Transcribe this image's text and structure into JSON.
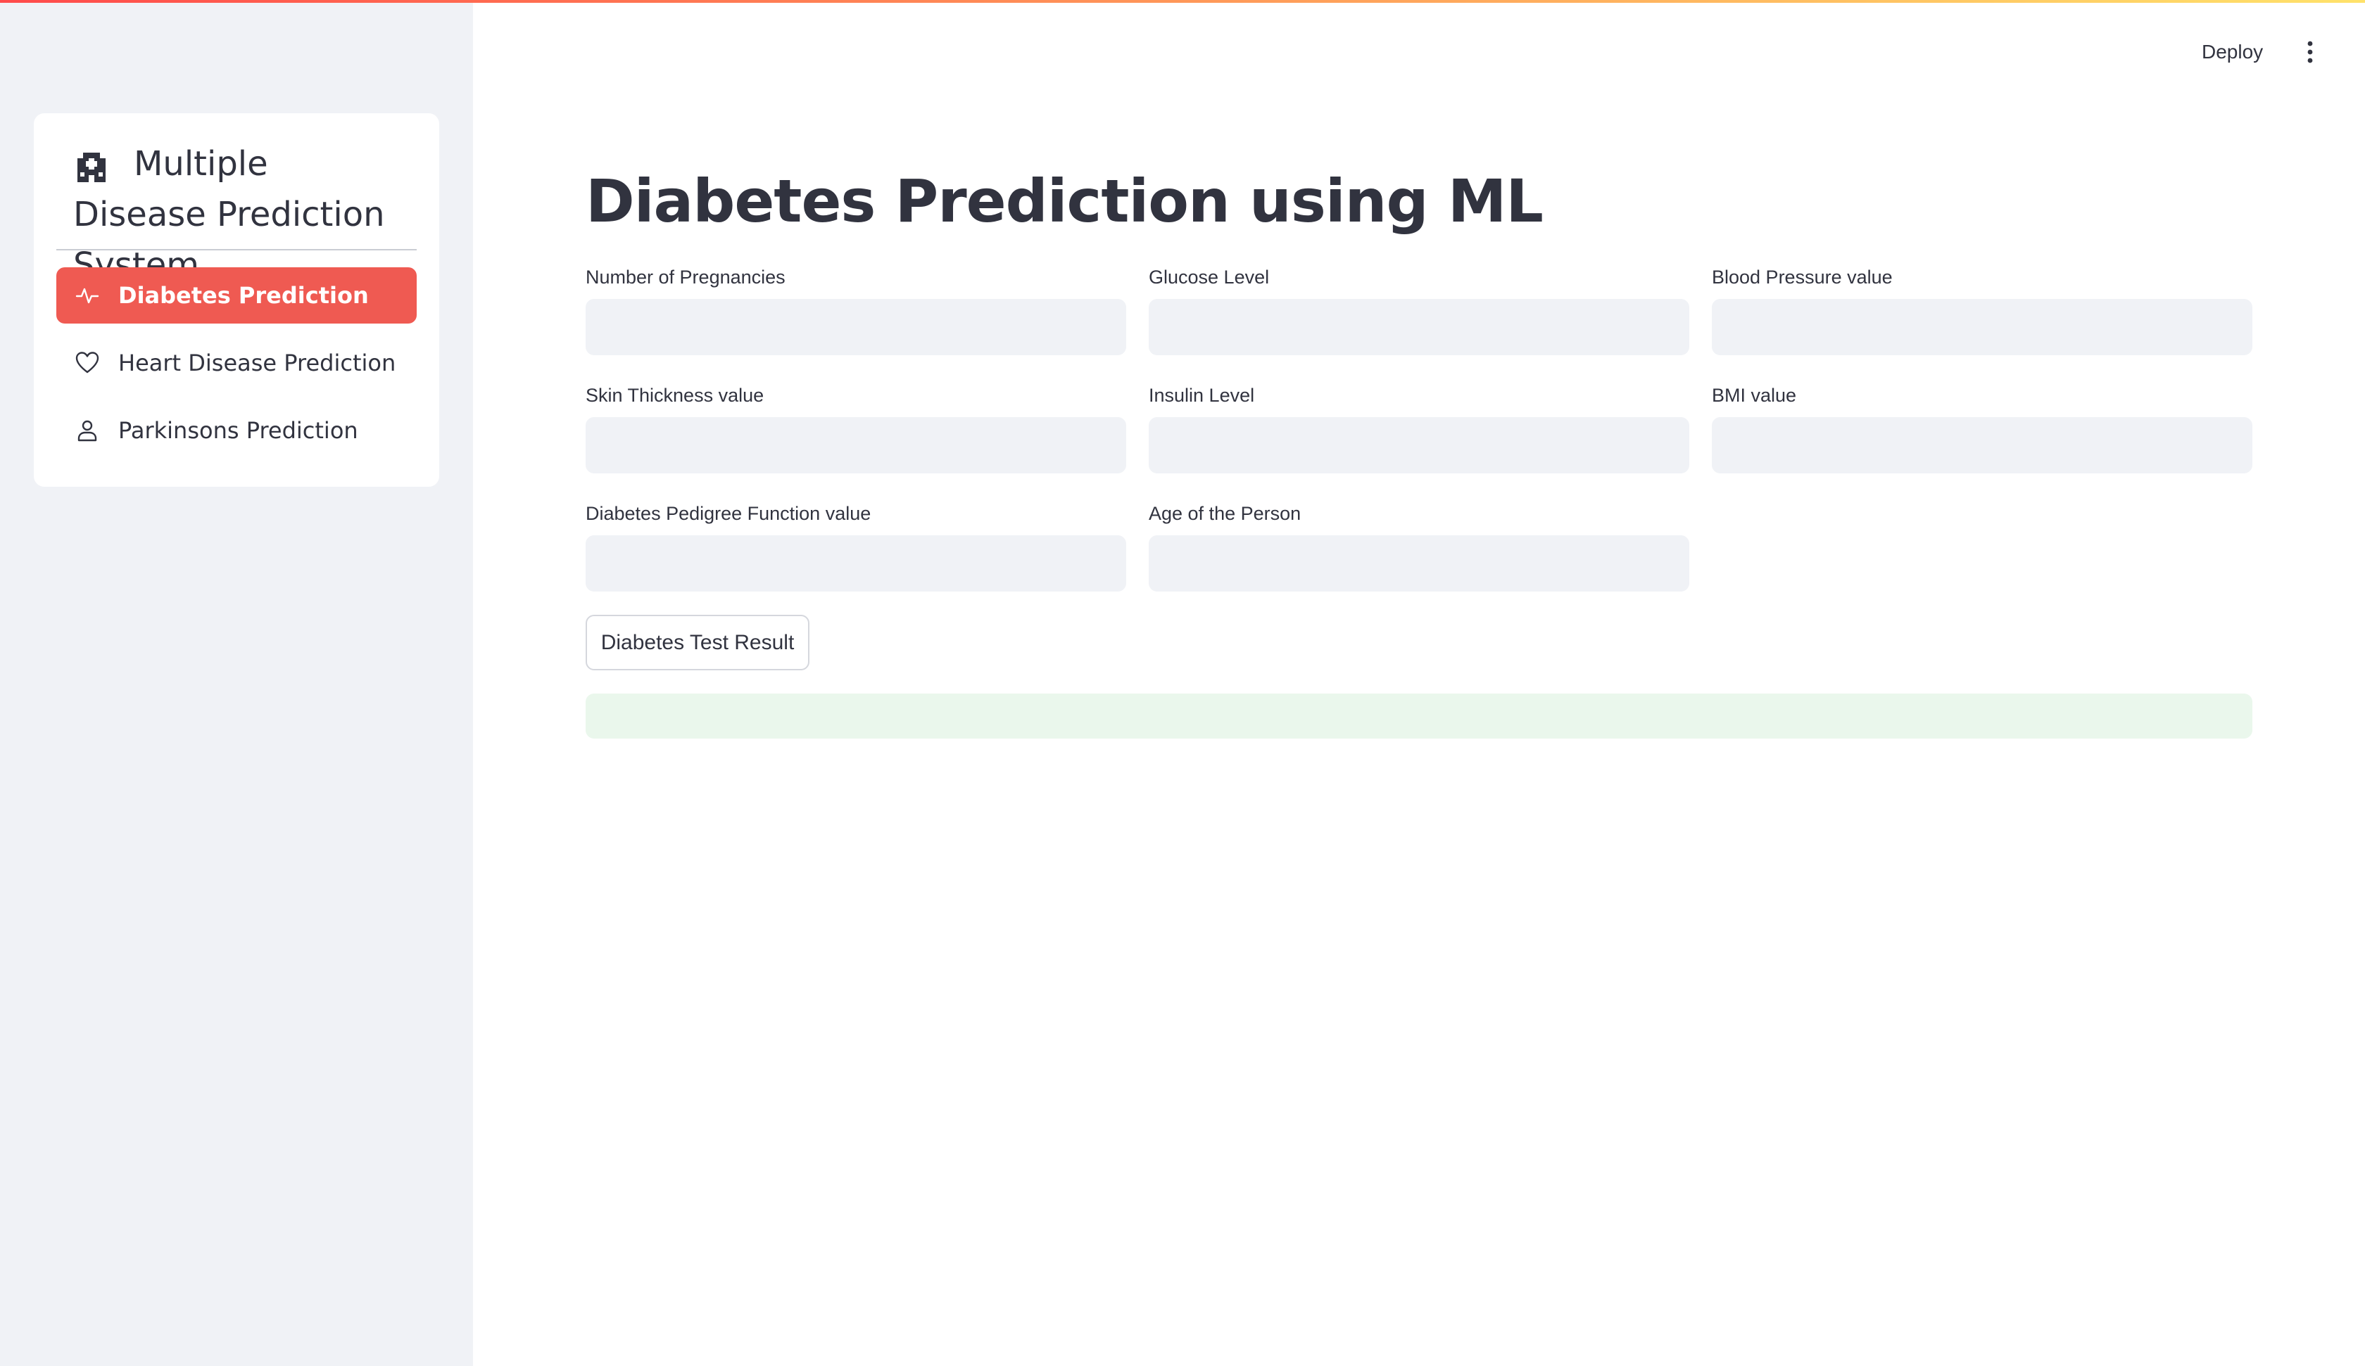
{
  "sidebar": {
    "menu_title": "Multiple Disease Prediction System",
    "title_icon": "hospital-icon",
    "items": [
      {
        "label": "Diabetes Prediction",
        "icon": "activity-icon",
        "active": true
      },
      {
        "label": "Heart Disease Prediction",
        "icon": "heart-icon",
        "active": false
      },
      {
        "label": "Parkinsons Prediction",
        "icon": "person-icon",
        "active": false
      }
    ],
    "active_color": "#ef5a52",
    "background_color": "#f0f2f6"
  },
  "header": {
    "deploy_label": "Deploy",
    "menu_icon": "kebab-menu-icon"
  },
  "main": {
    "title": "Diabetes Prediction using ML",
    "fields": [
      {
        "label": "Number of Pregnancies",
        "value": ""
      },
      {
        "label": "Glucose Level",
        "value": ""
      },
      {
        "label": "Blood Pressure value",
        "value": ""
      },
      {
        "label": "Skin Thickness value",
        "value": ""
      },
      {
        "label": "Insulin Level",
        "value": ""
      },
      {
        "label": "BMI value",
        "value": ""
      },
      {
        "label": "Diabetes Pedigree Function value",
        "value": ""
      },
      {
        "label": "Age of the Person",
        "value": ""
      }
    ],
    "button_label": "Diabetes Test Result",
    "result_text": ""
  }
}
